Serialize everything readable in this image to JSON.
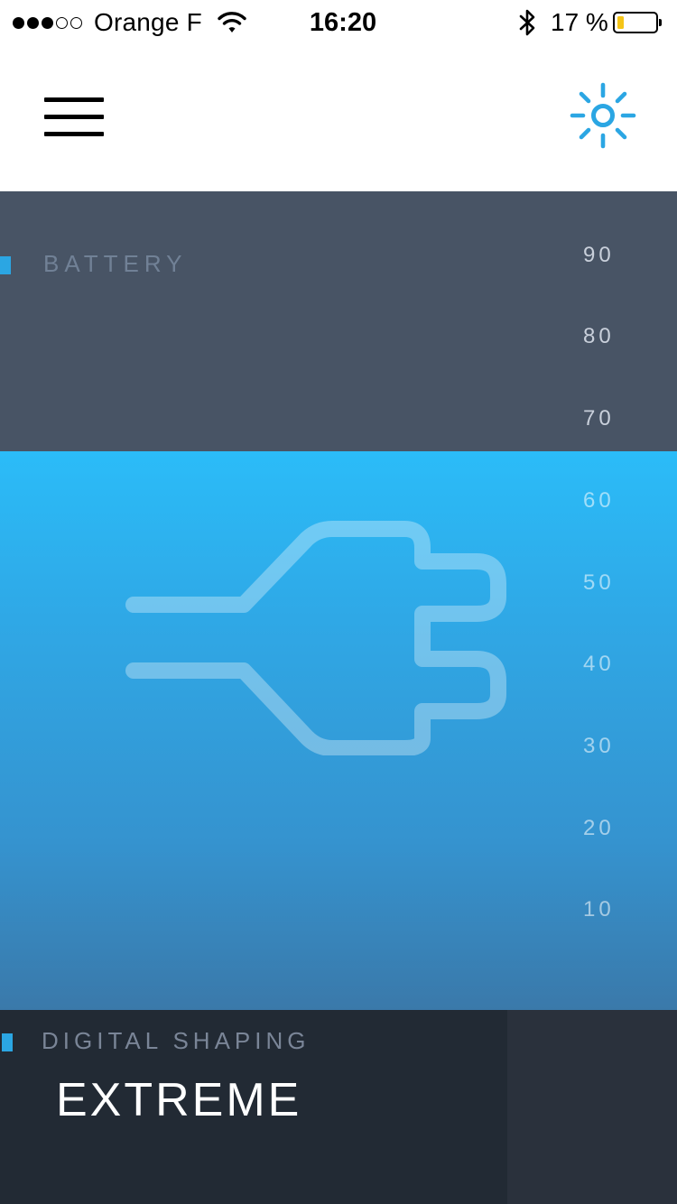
{
  "status_bar": {
    "signal_dots_filled": 3,
    "signal_dots_total": 5,
    "carrier": "Orange F",
    "time": "16:20",
    "battery_percent_text": "17 %",
    "battery_level_percent": 17,
    "battery_fill_color": "#f5c518",
    "icons": [
      "wifi-icon",
      "bluetooth-icon",
      "battery-icon"
    ]
  },
  "nav": {
    "left_icon": "hamburger-menu-icon",
    "right_icon": "brightness-sun-icon",
    "accent_color": "#2ba6e3"
  },
  "battery": {
    "label": "BATTERY",
    "level_percent": 66,
    "scale": [
      "90",
      "80",
      "70",
      "60",
      "50",
      "40",
      "30",
      "20",
      "10"
    ],
    "center_icon": "power-plug-icon",
    "panel_color": "#485465",
    "fill_color_top": "#2bbcf8",
    "fill_color_bottom": "#3a79aa"
  },
  "digital_shaping": {
    "label": "DIGITAL SHAPING",
    "value": "EXTREME"
  }
}
